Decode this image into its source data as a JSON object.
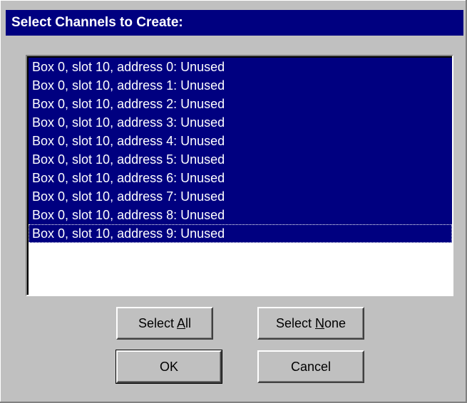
{
  "dialog": {
    "title": "Select Channels to Create:"
  },
  "channels": [
    {
      "label": "Box 0, slot 10, address 0: Unused"
    },
    {
      "label": "Box 0, slot 10, address 1: Unused"
    },
    {
      "label": "Box 0, slot 10, address 2: Unused"
    },
    {
      "label": "Box 0, slot 10, address 3: Unused"
    },
    {
      "label": "Box 0, slot 10, address 4: Unused"
    },
    {
      "label": "Box 0, slot 10, address 5: Unused"
    },
    {
      "label": "Box 0, slot 10, address 6: Unused"
    },
    {
      "label": "Box 0, slot 10, address 7: Unused"
    },
    {
      "label": "Box 0, slot 10, address 8: Unused"
    },
    {
      "label": "Box 0, slot 10, address 9: Unused"
    }
  ],
  "buttons": {
    "select_all": {
      "pre": "Select ",
      "mnemonic": "A",
      "post": "ll"
    },
    "select_none": {
      "pre": "Select ",
      "mnemonic": "N",
      "post": "one"
    },
    "ok": "OK",
    "cancel": "Cancel"
  },
  "colors": {
    "title_bar": "#000080",
    "selection": "#000080",
    "face": "#c0c0c0"
  }
}
